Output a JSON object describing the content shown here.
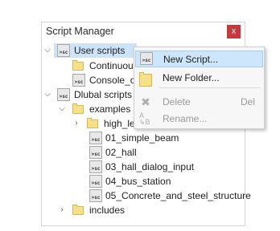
{
  "panel": {
    "title": "Script Manager",
    "close_glyph": "x"
  },
  "tree": {
    "user_scripts": "User scripts",
    "continuous": "Continuou",
    "console": "Console_o",
    "dlubal_scripts": "Dlubal scripts",
    "examples": "examples",
    "high_level": "high_le",
    "items": [
      "01_simple_beam",
      "02_hall",
      "03_hall_dialog_input",
      "04_bus_station",
      "05_Concrete_and_steel_structure"
    ],
    "includes": "includes",
    "sc_badge": ">sc"
  },
  "context_menu": {
    "new_script": "New Script...",
    "new_folder": "New Folder...",
    "delete": "Delete",
    "delete_shortcut": "Del",
    "rename": "Rename..."
  },
  "colors": {
    "close": "#c8373a",
    "selection": "#cde3f7",
    "menu_highlight": "#cde6fb"
  }
}
